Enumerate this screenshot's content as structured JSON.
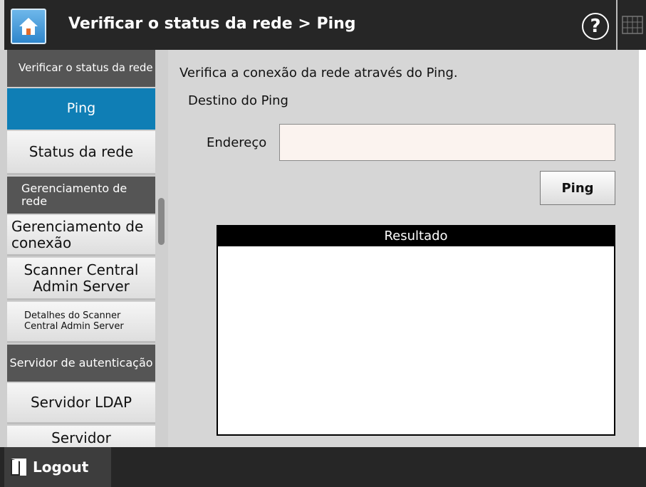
{
  "header": {
    "title": "Verificar o status da rede > Ping",
    "home_icon": "home-icon",
    "help_label": "?",
    "keyboard_icon": "keyboard-icon"
  },
  "sidebar": {
    "items": [
      {
        "label": "Verificar o status da rede",
        "kind": "header"
      },
      {
        "label": "Ping",
        "kind": "item",
        "active": true
      },
      {
        "label": "Status da rede",
        "kind": "item"
      },
      {
        "label": "Gerenciamento de rede",
        "kind": "header"
      },
      {
        "label": "Gerenciamento de conexão",
        "kind": "item"
      },
      {
        "label": "Scanner Central Admin Server",
        "kind": "item"
      },
      {
        "label": "Detalhes do Scanner Central Admin Server",
        "kind": "item"
      },
      {
        "label": "Servidor de autenticação",
        "kind": "header"
      },
      {
        "label": "Servidor LDAP",
        "kind": "item"
      },
      {
        "label": "Servidor",
        "kind": "item"
      }
    ]
  },
  "main": {
    "description": "Verifica a conexão da rede através do Ping.",
    "destination_label": "Destino do Ping",
    "address_label": "Endereço",
    "address_value": "",
    "ping_button": "Ping",
    "result_header": "Resultado",
    "result_text": ""
  },
  "footer": {
    "logout_label": "Logout",
    "logout_icon": "logout-icon"
  },
  "colors": {
    "header_bg": "#262626",
    "active_item": "#0f7eb5",
    "section_header": "#555555",
    "panel_bg": "#d6d6d6"
  }
}
